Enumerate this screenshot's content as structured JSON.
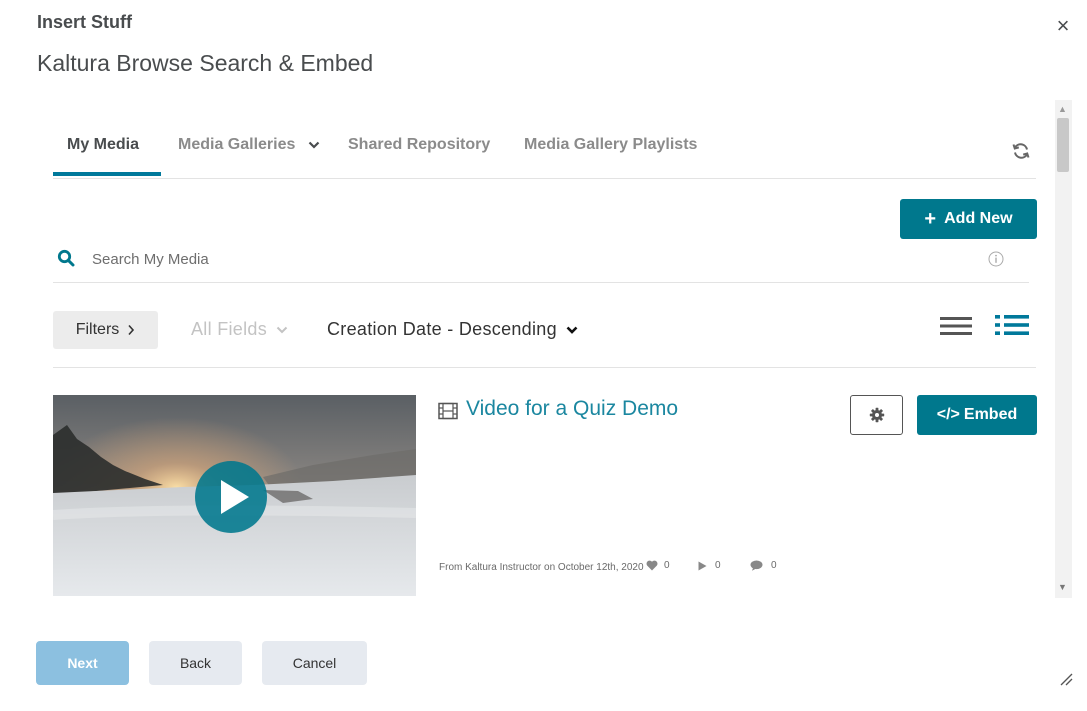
{
  "dialog": {
    "title": "Insert Stuff",
    "subtitle": "Kaltura Browse Search & Embed",
    "close_glyph": "×"
  },
  "tabs": [
    {
      "label": "My Media",
      "active": true
    },
    {
      "label": "Media Galleries",
      "has_dropdown": true
    },
    {
      "label": "Shared Repository"
    },
    {
      "label": "Media Gallery Playlists"
    }
  ],
  "toolbar": {
    "add_new_label": "Add New",
    "add_new_glyph": "+",
    "refresh_icon": "refresh-icon"
  },
  "search": {
    "placeholder": "Search My Media",
    "value": ""
  },
  "filters": {
    "filters_label": "Filters",
    "all_fields_label": "All Fields",
    "sort_label": "Creation Date - Descending"
  },
  "entry": {
    "title": "Video for a Quiz Demo",
    "meta": "From Kaltura Instructor on October 12th, 2020",
    "likes": "0",
    "plays": "0",
    "comments": "0",
    "embed_label": "Embed",
    "embed_glyph": "</>"
  },
  "footer": {
    "next_label": "Next",
    "back_label": "Back",
    "cancel_label": "Cancel"
  },
  "colors": {
    "accent": "#00788d",
    "link": "#1b87a0",
    "next_disabled": "#8cc0e0"
  }
}
